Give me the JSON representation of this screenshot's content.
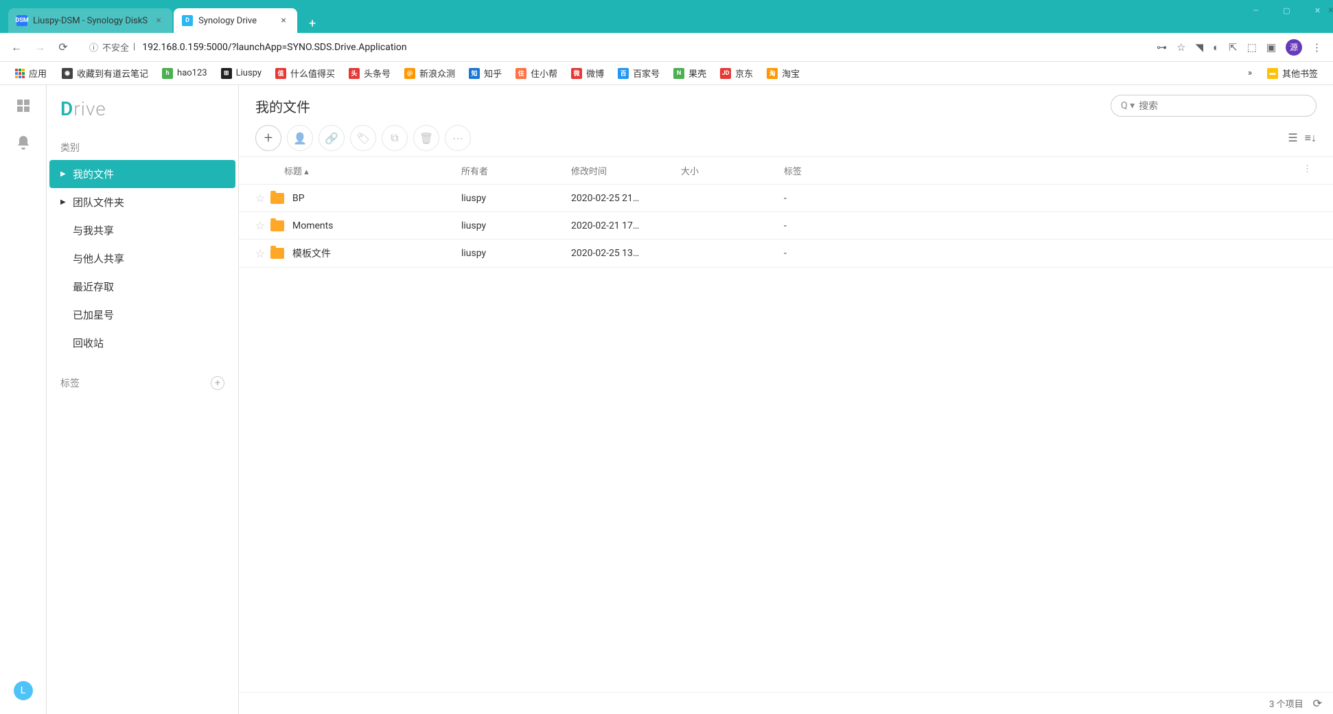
{
  "browser": {
    "tabs": [
      {
        "title": "Liuspy-DSM - Synology DiskS",
        "favicon_bg": "#2979ff",
        "favicon_text": "DSM",
        "active": false
      },
      {
        "title": "Synology Drive",
        "favicon_bg": "#29b6f6",
        "favicon_text": "D",
        "active": true
      }
    ],
    "url_security": "不安全",
    "url": "192.168.0.159:5000/?launchApp=SYNO.SDS.Drive.Application",
    "user_badge": "源",
    "apps_label": "应用",
    "bookmarks": [
      {
        "label": "收藏到有道云笔记",
        "icon_bg": "#424242",
        "icon_text": "◉"
      },
      {
        "label": "hao123",
        "icon_bg": "#4caf50",
        "icon_text": "h"
      },
      {
        "label": "Liuspy",
        "icon_bg": "#212121",
        "icon_text": "⊞"
      },
      {
        "label": "什么值得买",
        "icon_bg": "#e53935",
        "icon_text": "值"
      },
      {
        "label": "头条号",
        "icon_bg": "#e53935",
        "icon_text": "头"
      },
      {
        "label": "新浪众测",
        "icon_bg": "#ff9800",
        "icon_text": "@"
      },
      {
        "label": "知乎",
        "icon_bg": "#1976d2",
        "icon_text": "知"
      },
      {
        "label": "住小帮",
        "icon_bg": "#ff7043",
        "icon_text": "住"
      },
      {
        "label": "微博",
        "icon_bg": "#e53935",
        "icon_text": "微"
      },
      {
        "label": "百家号",
        "icon_bg": "#2196f3",
        "icon_text": "百"
      },
      {
        "label": "果壳",
        "icon_bg": "#4caf50",
        "icon_text": "N"
      },
      {
        "label": "京东",
        "icon_bg": "#e53935",
        "icon_text": "JD"
      },
      {
        "label": "淘宝",
        "icon_bg": "#ff9800",
        "icon_text": "淘"
      }
    ],
    "other_bookmarks": "其他书签"
  },
  "app": {
    "logo_d": "D",
    "logo_rest": "rive",
    "leftbar_user": "L",
    "sidebar": {
      "category_label": "类别",
      "items": [
        {
          "label": "我的文件",
          "caret": "▶",
          "active": true
        },
        {
          "label": "团队文件夹",
          "caret": "▶",
          "active": false
        },
        {
          "label": "与我共享",
          "caret": "",
          "active": false
        },
        {
          "label": "与他人共享",
          "caret": "",
          "active": false
        },
        {
          "label": "最近存取",
          "caret": "",
          "active": false
        },
        {
          "label": "已加星号",
          "caret": "",
          "active": false
        },
        {
          "label": "回收站",
          "caret": "",
          "active": false
        }
      ],
      "labels_label": "标签"
    },
    "main": {
      "title": "我的文件",
      "search_placeholder": "搜索",
      "columns": {
        "title": "标题 ▴",
        "owner": "所有者",
        "modified": "修改时间",
        "size": "大小",
        "tag": "标签"
      },
      "files": [
        {
          "name": "BP",
          "owner": "liuspy",
          "modified": "2020-02-25 21…",
          "size": "",
          "tag": "-"
        },
        {
          "name": "Moments",
          "owner": "liuspy",
          "modified": "2020-02-21 17…",
          "size": "",
          "tag": "-"
        },
        {
          "name": "模板文件",
          "owner": "liuspy",
          "modified": "2020-02-25 13…",
          "size": "",
          "tag": "-"
        }
      ],
      "status": "3 个项目"
    }
  }
}
